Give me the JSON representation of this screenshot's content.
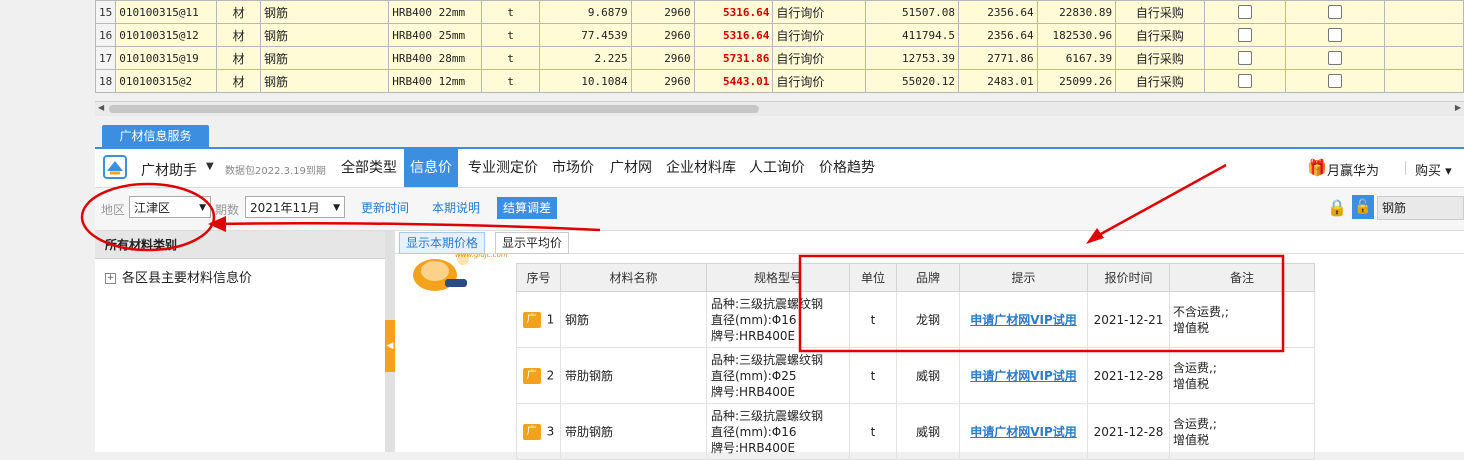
{
  "grid": {
    "rows": [
      {
        "idx": "15",
        "code": "010100315@11",
        "type": "材",
        "name": "钢筋",
        "spec": "HRB400 22mm",
        "unit": "t",
        "qty": "9.6879",
        "base": "2960",
        "price": "5316.64",
        "source": "自行询价",
        "amount": "51507.08",
        "diff": "2356.64",
        "diffamt": "22830.89",
        "purchase": "自行采购"
      },
      {
        "idx": "16",
        "code": "010100315@12",
        "type": "材",
        "name": "钢筋",
        "spec": "HRB400 25mm",
        "unit": "t",
        "qty": "77.4539",
        "base": "2960",
        "price": "5316.64",
        "source": "自行询价",
        "amount": "411794.5",
        "diff": "2356.64",
        "diffamt": "182530.96",
        "purchase": "自行采购"
      },
      {
        "idx": "17",
        "code": "010100315@19",
        "type": "材",
        "name": "钢筋",
        "spec": "HRB400 28mm",
        "unit": "t",
        "qty": "2.225",
        "base": "2960",
        "price": "5731.86",
        "source": "自行询价",
        "amount": "12753.39",
        "diff": "2771.86",
        "diffamt": "6167.39",
        "purchase": "自行采购"
      },
      {
        "idx": "18",
        "code": "010100315@2",
        "type": "材",
        "name": "钢筋",
        "spec": "HRB400 12mm",
        "unit": "t",
        "qty": "10.1084",
        "base": "2960",
        "price": "5443.01",
        "source": "自行询价",
        "amount": "55020.12",
        "diff": "2483.01",
        "diffamt": "25099.26",
        "purchase": "自行采购"
      }
    ]
  },
  "panel_tab": "广材信息服务",
  "menubar": {
    "app_title": "广材助手",
    "package_note": "数据包2022.3.19到期",
    "items": [
      "全部类型",
      "信息价",
      "专业测定价",
      "市场价",
      "广材网",
      "企业材料库",
      "人工询价",
      "价格趋势"
    ],
    "active_index": 1,
    "promo": "月赢华为",
    "buy": "购买"
  },
  "filters": {
    "region_label": "地区",
    "region_value": "江津区",
    "period_label": "期数",
    "period_value": "2021年11月",
    "refresh": "更新时间",
    "notes": "本期说明",
    "settle": "结算调差",
    "search_value": "钢筋"
  },
  "left": {
    "header": "所有材料类别",
    "tree_item": "各区县主要材料信息价"
  },
  "subtabs": [
    "显示本期价格",
    "显示平均价"
  ],
  "mascot_logo": "www.gldjc.com",
  "table": {
    "headers": [
      "序号",
      "材料名称",
      "规格型号",
      "单位",
      "品牌",
      "提示",
      "报价时间",
      "备注"
    ],
    "badge": "广",
    "rows": [
      {
        "no": "1",
        "name": "钢筋",
        "spec": [
          "品种:三级抗震螺纹钢",
          "直径(mm):Φ16",
          "牌号:HRB400E"
        ],
        "unit": "t",
        "brand": "龙钢",
        "tip": "申请广材网VIP试用",
        "date": "2021-12-21",
        "note": [
          "不含运费,;",
          "增值税"
        ]
      },
      {
        "no": "2",
        "name": "带肋钢筋",
        "spec": [
          "品种:三级抗震螺纹钢",
          "直径(mm):Φ25",
          "牌号:HRB400E"
        ],
        "unit": "t",
        "brand": "威钢",
        "tip": "申请广材网VIP试用",
        "date": "2021-12-28",
        "note": [
          "含运费,;",
          "增值税"
        ]
      },
      {
        "no": "3",
        "name": "带肋钢筋",
        "spec": [
          "品种:三级抗震螺纹钢",
          "直径(mm):Φ16",
          "牌号:HRB400E"
        ],
        "unit": "t",
        "brand": "威钢",
        "tip": "申请广材网VIP试用",
        "date": "2021-12-28",
        "note": [
          "含运费,;",
          "增值税"
        ]
      }
    ]
  },
  "colors": {
    "accent": "#3c8ee0",
    "annotation": "#e00000",
    "price_red": "#d00000",
    "badge": "#f3a21b"
  }
}
